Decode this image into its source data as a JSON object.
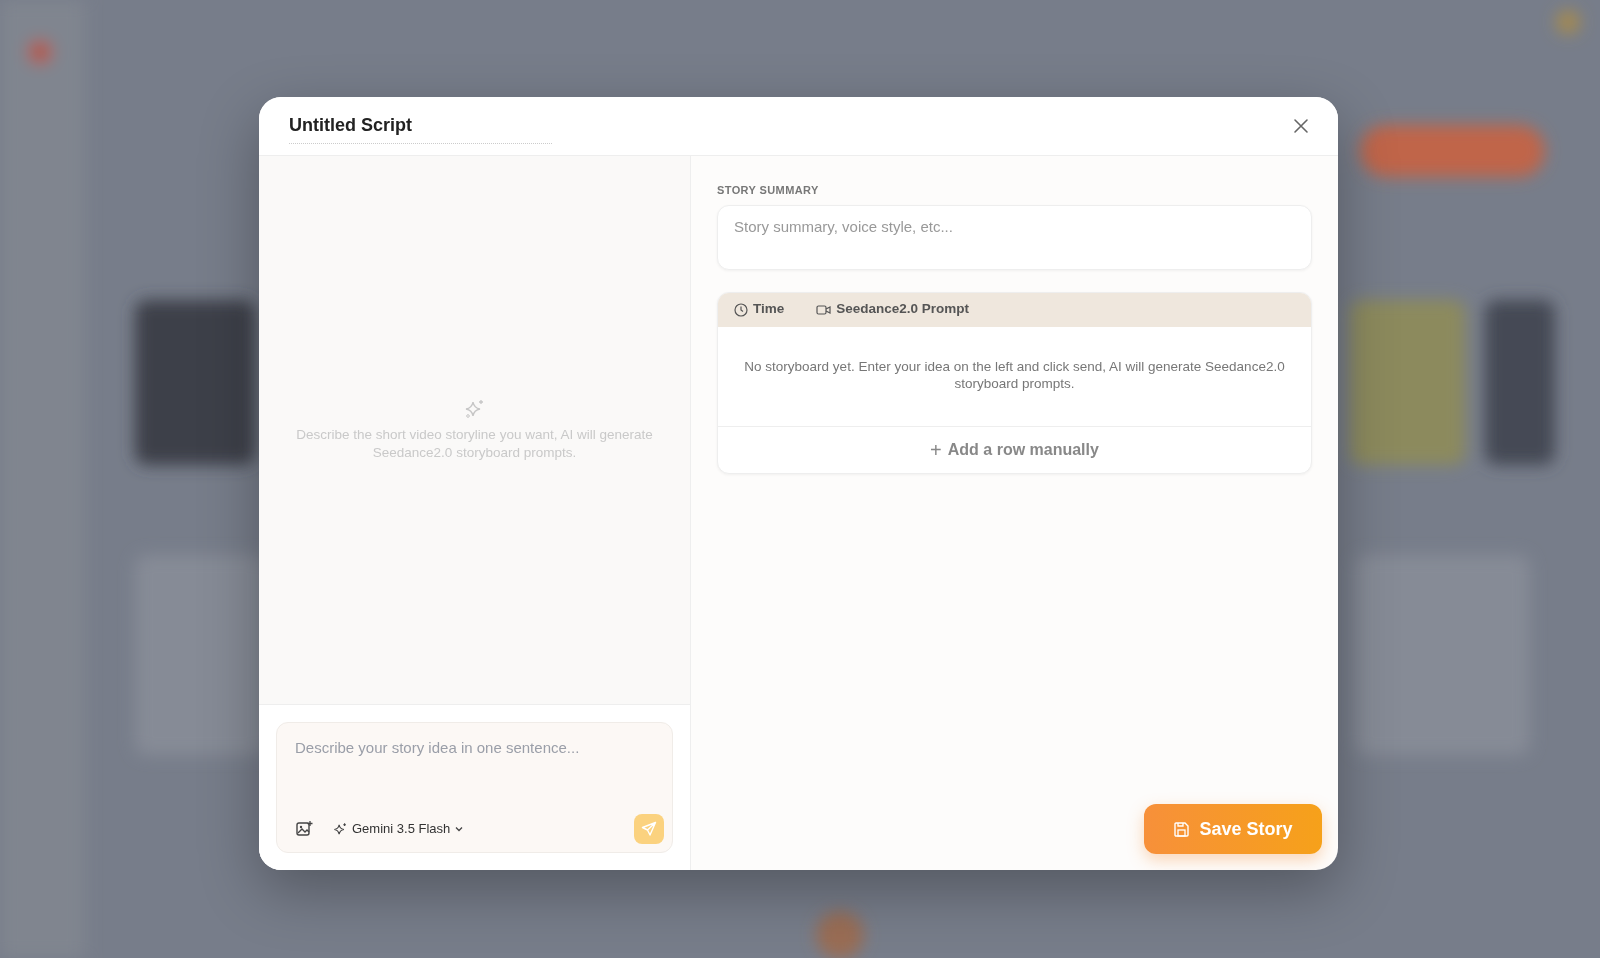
{
  "dialog": {
    "title": "Untitled Script",
    "left_pane": {
      "empty_hint": "Describe the short video storyline you want, AI will generate Seedance2.0 storyboard prompts.",
      "composer": {
        "placeholder": "Describe your story idea in one sentence...",
        "model": "Gemini 3.5 Flash"
      }
    },
    "right_pane": {
      "summary_label": "STORY SUMMARY",
      "summary": {
        "placeholder": "Story summary, voice style, etc..."
      },
      "storyboard": {
        "columns": [
          {
            "kind": "time",
            "label": "Time"
          },
          {
            "kind": "prompt",
            "label": "Seedance2.0 Prompt"
          }
        ],
        "empty_text": "No storyboard yet. Enter your idea on the left and click send, AI will generate Seedance2.0 storyboard prompts.",
        "add_row": "+",
        "add_row_label": "Add a row manually"
      },
      "save_button": "Save Story"
    }
  }
}
